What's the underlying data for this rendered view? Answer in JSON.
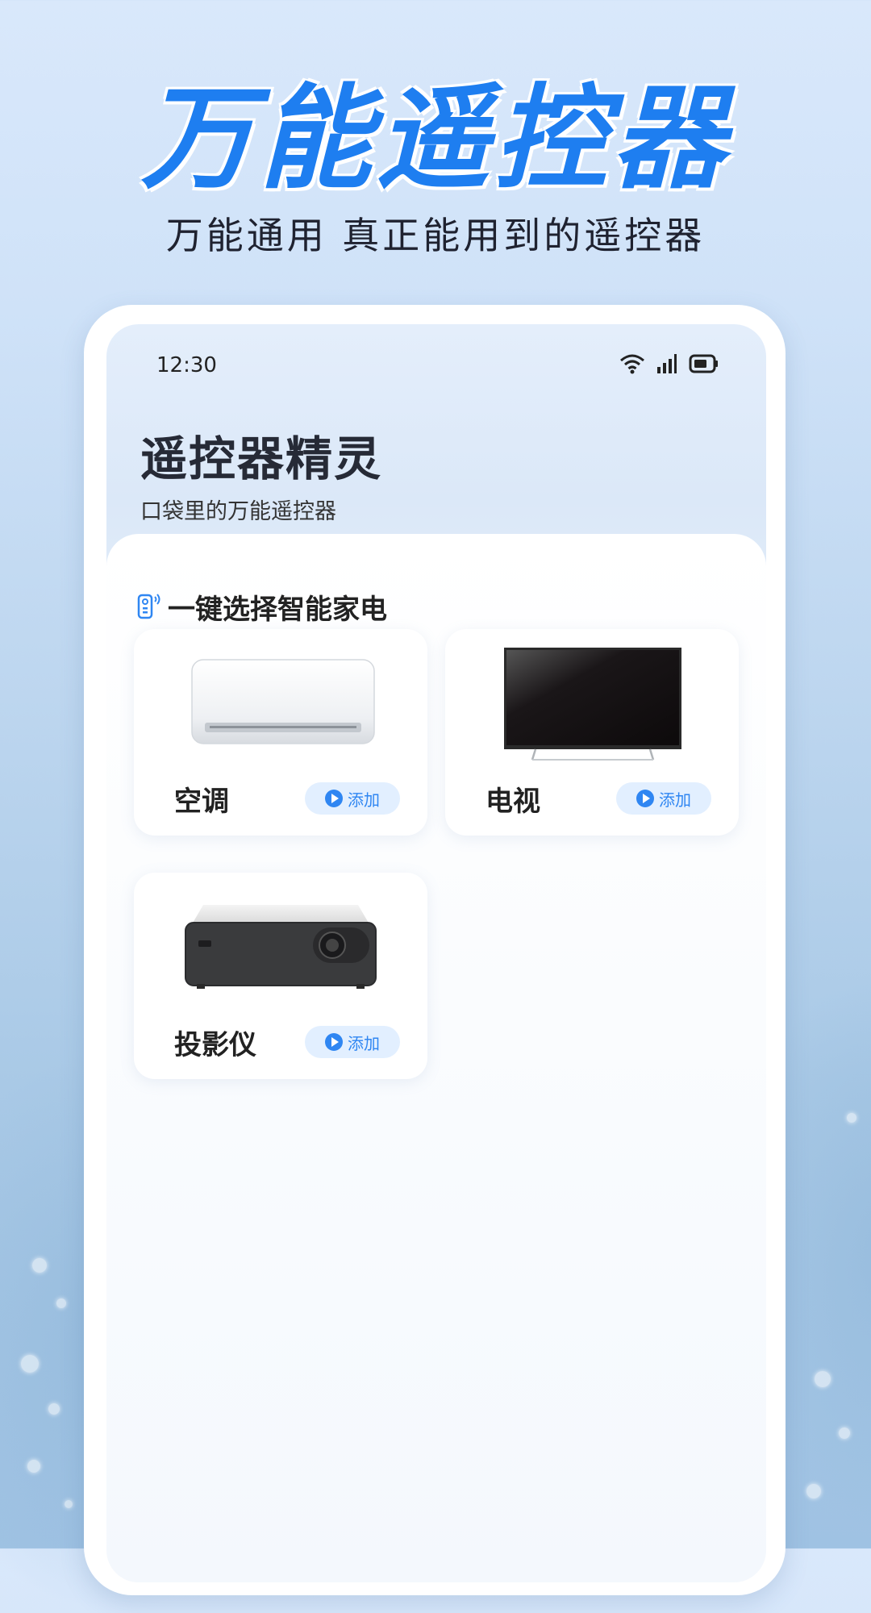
{
  "hero": {
    "title": "万能遥控器",
    "subtitle": "万能通用  真正能用到的遥控器"
  },
  "status_bar": {
    "time": "12:30",
    "icons": [
      "wifi-icon",
      "signal-icon",
      "battery-icon"
    ]
  },
  "app": {
    "title": "遥控器精灵",
    "subtitle": "口袋里的万能遥控器"
  },
  "section": {
    "icon": "remote-icon",
    "label": "一键选择智能家电"
  },
  "devices": [
    {
      "name": "空调",
      "image": "air-conditioner",
      "button": "添加"
    },
    {
      "name": "电视",
      "image": "television",
      "button": "添加"
    },
    {
      "name": "投影仪",
      "image": "projector",
      "button": "添加"
    }
  ],
  "colors": {
    "accent": "#1e7ef0",
    "button_bg": "#e2efff",
    "button_text": "#2f86f2"
  }
}
